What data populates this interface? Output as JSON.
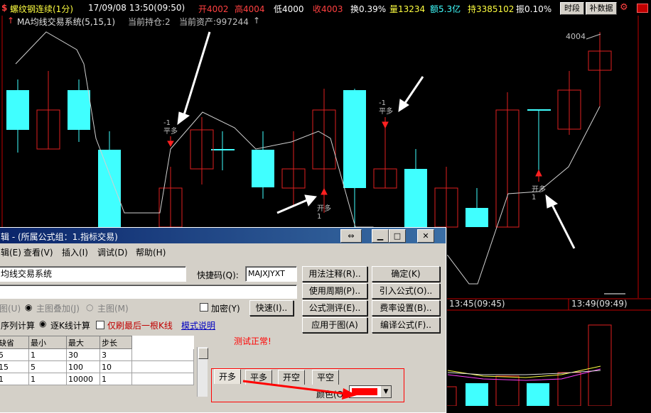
{
  "header": {
    "instrument": "螺纹钢连续(1分)",
    "datetime": "17/09/08  13:50(09:50)",
    "open": "开4002",
    "high": "高4004",
    "low": "低4000",
    "close": "收4003",
    "turnover_rate": "换0.39%",
    "volume": "量13234",
    "amount": "额5.3亿",
    "position": "持3385102",
    "amplitude": "振0.10%",
    "btn_timeshare": "时段",
    "btn_supplement": "补数据"
  },
  "subheader": {
    "system": "MA均线交易系统(5,15,1)",
    "holding": "当前持仓:2",
    "assets": "当前资产:997244"
  },
  "chart_data": {
    "type": "candlestick",
    "high_label": "4004",
    "annotations": [
      "-1\n平多",
      "开多\n1",
      "-1\n平多",
      "开多\n1"
    ],
    "time_labels": [
      "13:45(09:45)",
      "13:49(09:49)"
    ]
  },
  "dialog": {
    "title": "辑 - (所属公式组：1.指标交易)",
    "menu": [
      "辑(E)",
      "查看(V)",
      "插入(I)",
      "调试(D)",
      "帮助(H)"
    ],
    "name_value": "均线交易系统",
    "shortcut_label": "快捷码(Q):",
    "shortcut_value": "MAJXJYXT",
    "right_buttons": [
      "用法注释(R)..",
      "确定(K)",
      "使用周期(P)..",
      "引入公式(O)..",
      "公式测评(E)..",
      "费率设置(B)..",
      "应用于图(A)",
      "编译公式(F).."
    ],
    "mode_main_disabled": "图(U)",
    "mode_overlay": "主图叠加(J)",
    "mode_main": "主图(M)",
    "encrypt": "加密(Y)",
    "quick": "快速(I)..",
    "calc_seq": "序列计算",
    "calc_each": "逐K线计算",
    "last_bar": "仅刷最后一根K线",
    "template_help": "模式说明",
    "table": {
      "headers": [
        "缺省",
        "最小",
        "最大",
        "步长"
      ],
      "rows": [
        [
          "5",
          "1",
          "30",
          "3"
        ],
        [
          "15",
          "5",
          "100",
          "10"
        ],
        [
          "1",
          "1",
          "10000",
          "1"
        ]
      ]
    },
    "test_ok": "测试正常!",
    "tabs": [
      "开多",
      "平多",
      "开空",
      "平空"
    ],
    "color_label": "颜色(O):"
  }
}
